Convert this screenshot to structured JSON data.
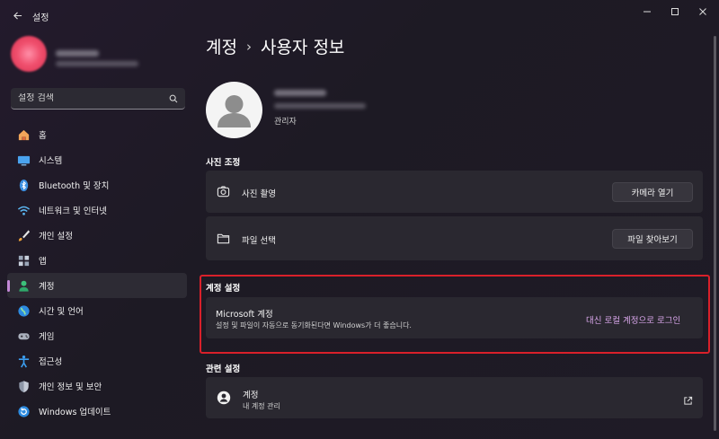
{
  "window": {
    "app_title": "설정"
  },
  "sidebar": {
    "search_placeholder": "설정 검색",
    "items": [
      {
        "label": "홈",
        "icon": "home-icon"
      },
      {
        "label": "시스템",
        "icon": "system-icon"
      },
      {
        "label": "Bluetooth 및 장치",
        "icon": "bluetooth-icon"
      },
      {
        "label": "네트워크 및 인터넷",
        "icon": "wifi-icon"
      },
      {
        "label": "개인 설정",
        "icon": "brush-icon"
      },
      {
        "label": "앱",
        "icon": "apps-icon"
      },
      {
        "label": "계정",
        "icon": "account-icon",
        "active": true
      },
      {
        "label": "시간 및 언어",
        "icon": "globe-icon"
      },
      {
        "label": "게임",
        "icon": "gamepad-icon"
      },
      {
        "label": "접근성",
        "icon": "accessibility-icon"
      },
      {
        "label": "개인 정보 및 보안",
        "icon": "shield-icon"
      },
      {
        "label": "Windows 업데이트",
        "icon": "update-icon"
      }
    ]
  },
  "main": {
    "breadcrumb": {
      "parent": "계정",
      "separator": "›",
      "current": "사용자 정보"
    },
    "profile": {
      "role": "관리자"
    },
    "photo_section": {
      "heading": "사진 조정",
      "take_photo_label": "사진 촬영",
      "open_camera_button": "카메라 열기",
      "choose_file_label": "파일 선택",
      "browse_files_button": "파일 찾아보기"
    },
    "account_settings": {
      "heading": "계정 설정",
      "ms_account_title": "Microsoft 계정",
      "ms_account_desc": "설정 및 파일이 자동으로 동기화된다면 Windows가 더 좋습니다.",
      "local_signin_link": "대신 로컬 계정으로 로그인"
    },
    "related_settings": {
      "heading": "관련 설정",
      "accounts_title": "계정",
      "accounts_desc": "내 계정 관리"
    }
  },
  "colors": {
    "accent": "#c287d6",
    "highlight_border": "#d9202a",
    "card_bg": "#2a2830"
  }
}
